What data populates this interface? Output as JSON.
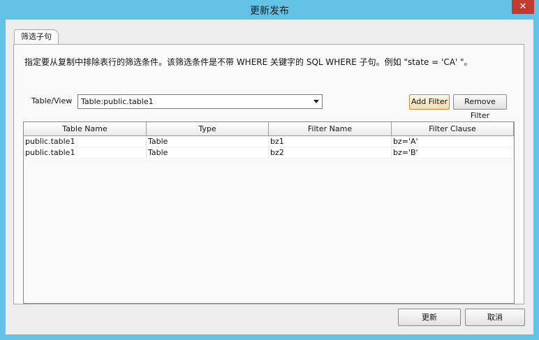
{
  "window": {
    "title": "更新发布",
    "close_icon": "✕"
  },
  "tab": {
    "label": "筛选子句"
  },
  "description": "指定要从复制中排除表行的筛选条件。该筛选条件是不带 WHERE 关键字的 SQL WHERE 子句。例如 \"state = 'CA' \"。",
  "table_view": {
    "label": "Table/View",
    "selected": "Table:public.table1"
  },
  "buttons": {
    "add_filter": "Add Filter",
    "remove_filter": "Remove Filter",
    "update": "更新",
    "cancel": "取消"
  },
  "grid": {
    "columns": [
      "Table Name",
      "Type",
      "Filter Name",
      "Filter Clause"
    ],
    "rows": [
      [
        "public.table1",
        "Table",
        "bz1",
        "bz='A'"
      ],
      [
        "public.table1",
        "Table",
        "bz2",
        "bz='B'"
      ]
    ]
  }
}
